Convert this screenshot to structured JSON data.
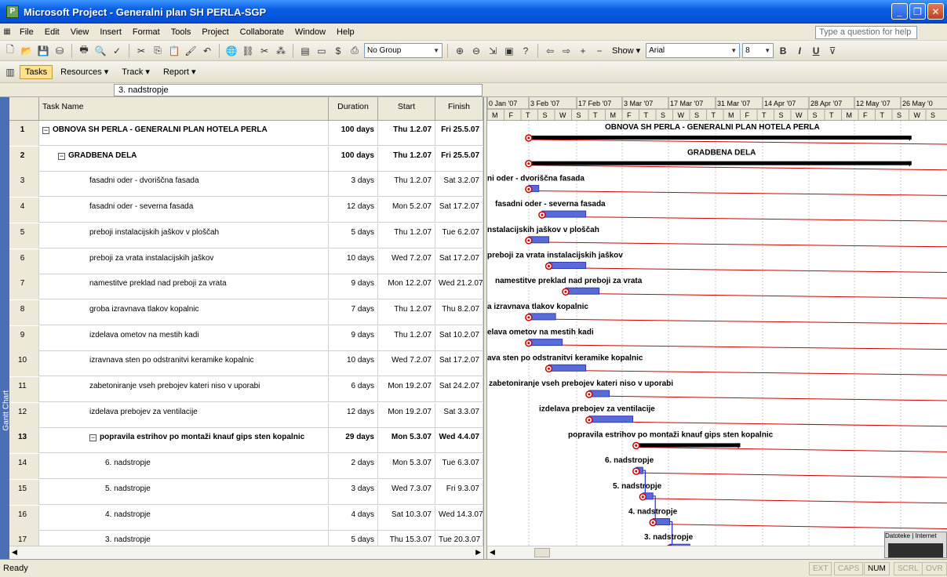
{
  "window": {
    "title": "Microsoft Project - Generalni plan SH PERLA-SGP"
  },
  "menu": [
    "File",
    "Edit",
    "View",
    "Insert",
    "Format",
    "Tools",
    "Project",
    "Collaborate",
    "Window",
    "Help"
  ],
  "help_placeholder": "Type a question for help",
  "toolbar": {
    "group_combo": "No Group",
    "show_label": "Show",
    "font_combo": "Arial",
    "size_combo": "8"
  },
  "guide": {
    "tasks": "Tasks",
    "resources": "Resources",
    "track": "Track",
    "report": "Report"
  },
  "entry_value": "3. nadstropje",
  "columns": {
    "name": "Task Name",
    "duration": "Duration",
    "start": "Start",
    "finish": "Finish"
  },
  "side_label": "Gantt Chart",
  "rows": [
    {
      "id": "1",
      "name": "OBNOVA SH PERLA - GENERALNI PLAN HOTELA PERLA",
      "duration": "100 days",
      "start": "Thu 1.2.07",
      "finish": "Fri 25.5.07",
      "level": 0,
      "summary": true
    },
    {
      "id": "2",
      "name": "GRADBENA DELA",
      "duration": "100 days",
      "start": "Thu 1.2.07",
      "finish": "Fri 25.5.07",
      "level": 1,
      "summary": true
    },
    {
      "id": "3",
      "name": "fasadni oder - dvoriščna fasada",
      "duration": "3 days",
      "start": "Thu 1.2.07",
      "finish": "Sat 3.2.07",
      "level": 2,
      "summary": false
    },
    {
      "id": "4",
      "name": "fasadni oder - severna fasada",
      "duration": "12 days",
      "start": "Mon 5.2.07",
      "finish": "Sat 17.2.07",
      "level": 2,
      "summary": false
    },
    {
      "id": "5",
      "name": "preboji instalacijskih jaškov v ploščah",
      "duration": "5 days",
      "start": "Thu 1.2.07",
      "finish": "Tue 6.2.07",
      "level": 2,
      "summary": false
    },
    {
      "id": "6",
      "name": "preboji za vrata instalacijskih jaškov",
      "duration": "10 days",
      "start": "Wed 7.2.07",
      "finish": "Sat 17.2.07",
      "level": 2,
      "summary": false
    },
    {
      "id": "7",
      "name": "namestitve preklad nad preboji za vrata",
      "duration": "9 days",
      "start": "Mon 12.2.07",
      "finish": "Wed 21.2.07",
      "level": 2,
      "summary": false
    },
    {
      "id": "8",
      "name": "groba izravnava tlakov kopalnic",
      "duration": "7 days",
      "start": "Thu 1.2.07",
      "finish": "Thu 8.2.07",
      "level": 2,
      "summary": false
    },
    {
      "id": "9",
      "name": "izdelava ometov na mestih kadi",
      "duration": "9 days",
      "start": "Thu 1.2.07",
      "finish": "Sat 10.2.07",
      "level": 2,
      "summary": false
    },
    {
      "id": "10",
      "name": "izravnava sten po odstranitvi keramike kopalnic",
      "duration": "10 days",
      "start": "Wed 7.2.07",
      "finish": "Sat 17.2.07",
      "level": 2,
      "summary": false
    },
    {
      "id": "11",
      "name": "zabetoniranje vseh prebojev kateri niso v uporabi",
      "duration": "6 days",
      "start": "Mon 19.2.07",
      "finish": "Sat 24.2.07",
      "level": 2,
      "summary": false
    },
    {
      "id": "12",
      "name": "izdelava prebojev za ventilacije",
      "duration": "12 days",
      "start": "Mon 19.2.07",
      "finish": "Sat 3.3.07",
      "level": 2,
      "summary": false
    },
    {
      "id": "13",
      "name": "popravila estrihov po montaži knauf gips sten kopalnic",
      "duration": "29 days",
      "start": "Mon 5.3.07",
      "finish": "Wed 4.4.07",
      "level": 2,
      "summary": true
    },
    {
      "id": "14",
      "name": "6. nadstropje",
      "duration": "2 days",
      "start": "Mon 5.3.07",
      "finish": "Tue 6.3.07",
      "level": 3,
      "summary": false
    },
    {
      "id": "15",
      "name": "5. nadstropje",
      "duration": "3 days",
      "start": "Wed 7.3.07",
      "finish": "Fri 9.3.07",
      "level": 3,
      "summary": false
    },
    {
      "id": "16",
      "name": "4. nadstropje",
      "duration": "4 days",
      "start": "Sat 10.3.07",
      "finish": "Wed 14.3.07",
      "level": 3,
      "summary": false
    },
    {
      "id": "17",
      "name": "3. nadstropje",
      "duration": "5 days",
      "start": "Thu 15.3.07",
      "finish": "Tue 20.3.07",
      "level": 3,
      "summary": false
    }
  ],
  "gantt": {
    "weeks": [
      "0 Jan '07",
      "3 Feb '07",
      "17 Feb '07",
      "3 Mar '07",
      "17 Mar '07",
      "31 Mar '07",
      "14 Apr '07",
      "28 Apr '07",
      "12 May '07",
      "26 May '0"
    ],
    "days": [
      "M",
      "F",
      "T",
      "S",
      "W",
      "S",
      "T",
      "M",
      "F",
      "T",
      "S",
      "W",
      "S",
      "T",
      "M",
      "F",
      "T",
      "S",
      "W",
      "S",
      "T",
      "M",
      "F",
      "T",
      "S",
      "W",
      "S"
    ],
    "labels": [
      "OBNOVA SH PERLA - GENERALNI PLAN HOTELA PERLA",
      "GRADBENA DELA",
      "ni oder - dvoriščna fasada",
      "fasadni oder - severna fasada",
      "nstalacijskih jaškov v ploščah",
      "preboji za vrata instalacijskih jaškov",
      "namestitve preklad nad preboji za vrata",
      "a izravnava tlakov kopalnic",
      "elava ometov na mestih kadi",
      "ava sten po odstranitvi keramike kopalnic",
      "zabetoniranje vseh prebojev kateri niso v uporabi",
      "izdelava prebojev za ventilacije",
      "popravila estrihov po montaži knauf gips sten kopalnic",
      "6. nadstropje",
      "5. nadstropje",
      "4. nadstropje",
      "3. nadstropje"
    ],
    "colors": {
      "bar_fill": "#5a6bd8",
      "baseline": "#d00000",
      "summary": "#000000",
      "link": "#1d2fe0"
    }
  },
  "taskbar_popup": {
    "tab1": "Datoteke",
    "tab2": "Internet"
  },
  "status": {
    "ready": "Ready",
    "indicators": [
      "EXT",
      "CAPS",
      "NUM",
      "SCRL",
      "OVR"
    ],
    "active": "NUM"
  }
}
